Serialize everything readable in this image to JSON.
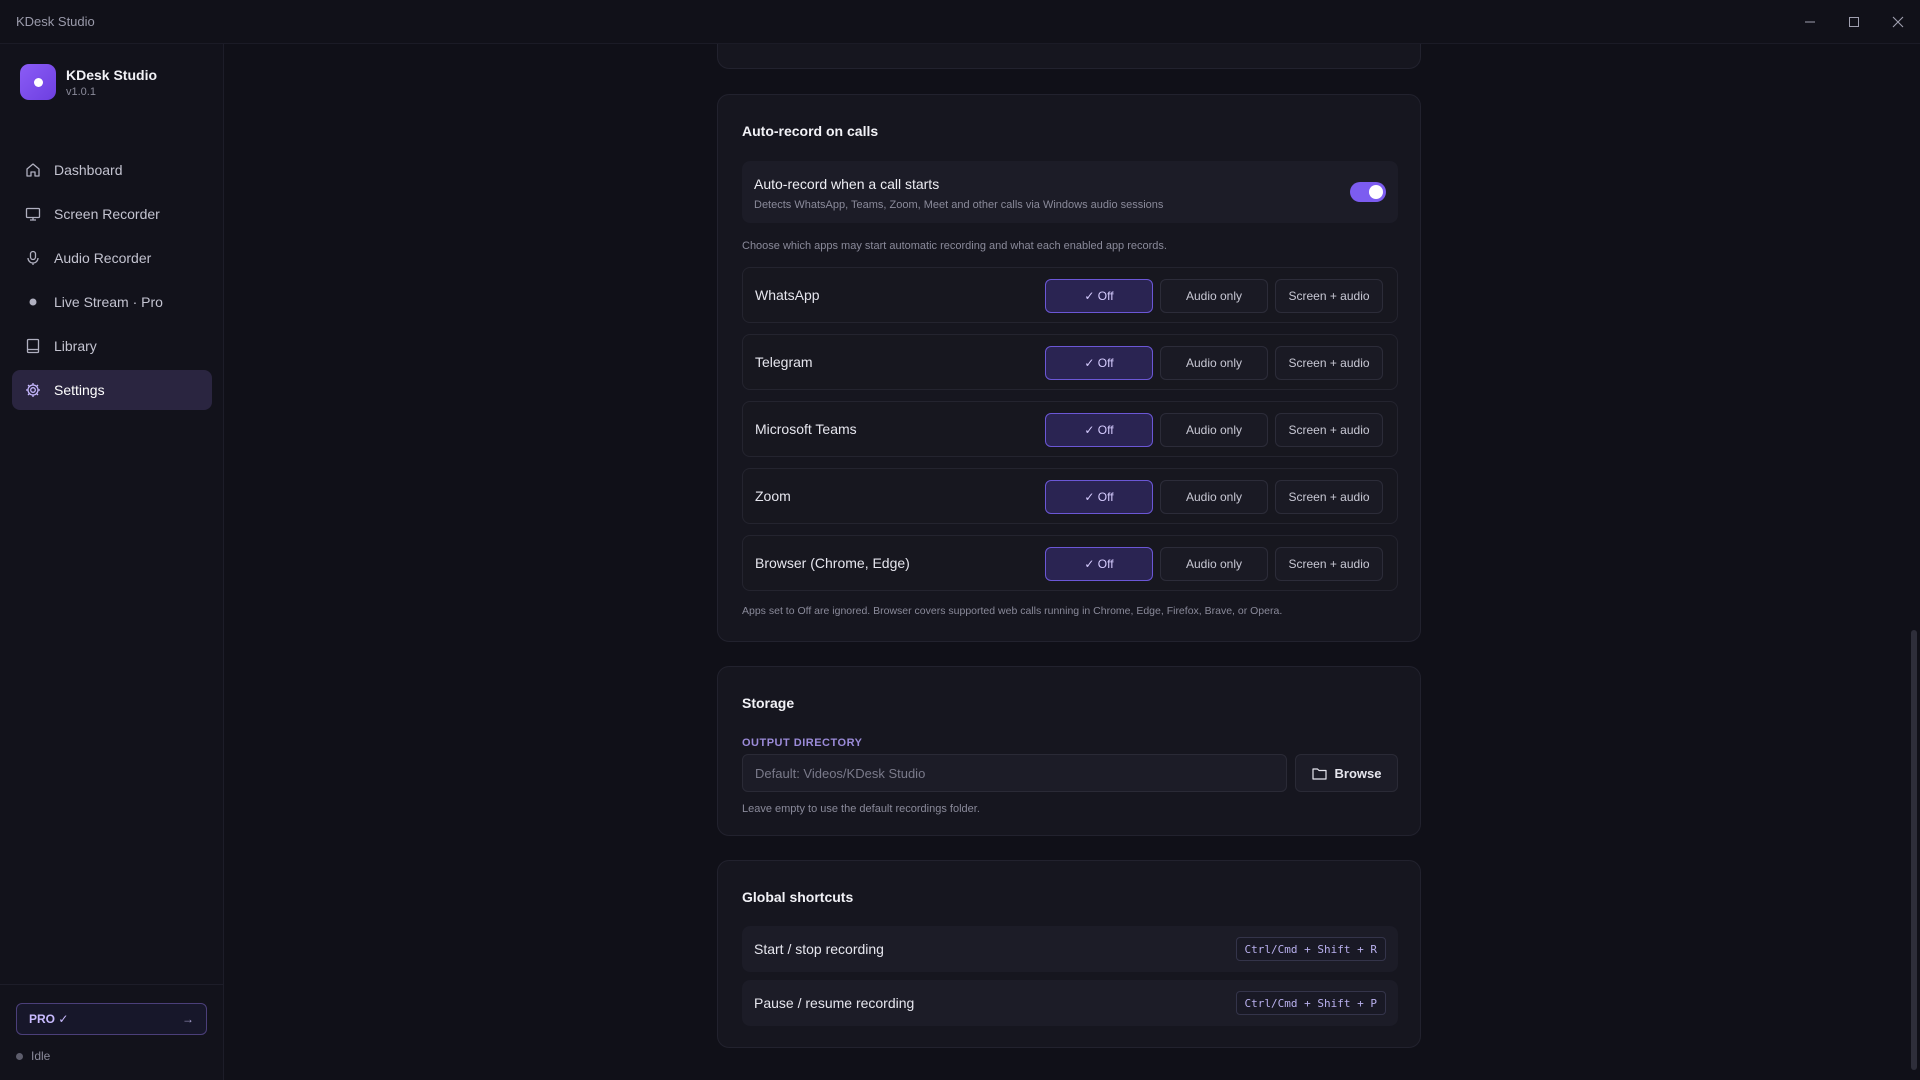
{
  "window": {
    "title": "KDesk Studio"
  },
  "brand": {
    "name": "KDesk Studio",
    "version": "v1.0.1",
    "accent": "#8b5cf6"
  },
  "nav": {
    "items": [
      {
        "label": "Dashboard",
        "icon": "home-icon"
      },
      {
        "label": "Screen Recorder",
        "icon": "monitor-icon"
      },
      {
        "label": "Audio Recorder",
        "icon": "microphone-icon"
      },
      {
        "label": "Live Stream · Pro",
        "icon": "dot-icon"
      },
      {
        "label": "Library",
        "icon": "book-icon"
      },
      {
        "label": "Settings",
        "icon": "gear-icon",
        "active": true
      }
    ]
  },
  "sidebar_footer": {
    "pro_label": "PRO ✓",
    "pro_arrow": "→",
    "status": "Idle"
  },
  "auto_record": {
    "title": "Auto-record on calls",
    "toggle_title": "Auto-record when a call starts",
    "toggle_desc": "Detects WhatsApp, Teams, Zoom, Meet and other calls via Windows audio sessions",
    "toggle_on": true,
    "helper": "Choose which apps may start automatic recording and what each enabled app records.",
    "options": {
      "off": "✓ Off",
      "audio": "Audio only",
      "screen": "Screen + audio"
    },
    "apps": [
      {
        "name": "WhatsApp",
        "selected": "off"
      },
      {
        "name": "Telegram",
        "selected": "off"
      },
      {
        "name": "Microsoft Teams",
        "selected": "off"
      },
      {
        "name": "Zoom",
        "selected": "off"
      },
      {
        "name": "Browser (Chrome, Edge)",
        "selected": "off"
      }
    ],
    "footnote": "Apps set to Off are ignored. Browser covers supported web calls running in Chrome, Edge, Firefox, Brave, or Opera."
  },
  "storage": {
    "title": "Storage",
    "output_label": "OUTPUT DIRECTORY",
    "placeholder": "Default: Videos/KDesk Studio",
    "value": "",
    "browse_label": "Browse",
    "helper": "Leave empty to use the default recordings folder."
  },
  "shortcuts": {
    "title": "Global shortcuts",
    "items": [
      {
        "label": "Start / stop recording",
        "keys": "Ctrl/Cmd + Shift + R"
      },
      {
        "label": "Pause / resume recording",
        "keys": "Ctrl/Cmd + Shift + P"
      }
    ]
  }
}
